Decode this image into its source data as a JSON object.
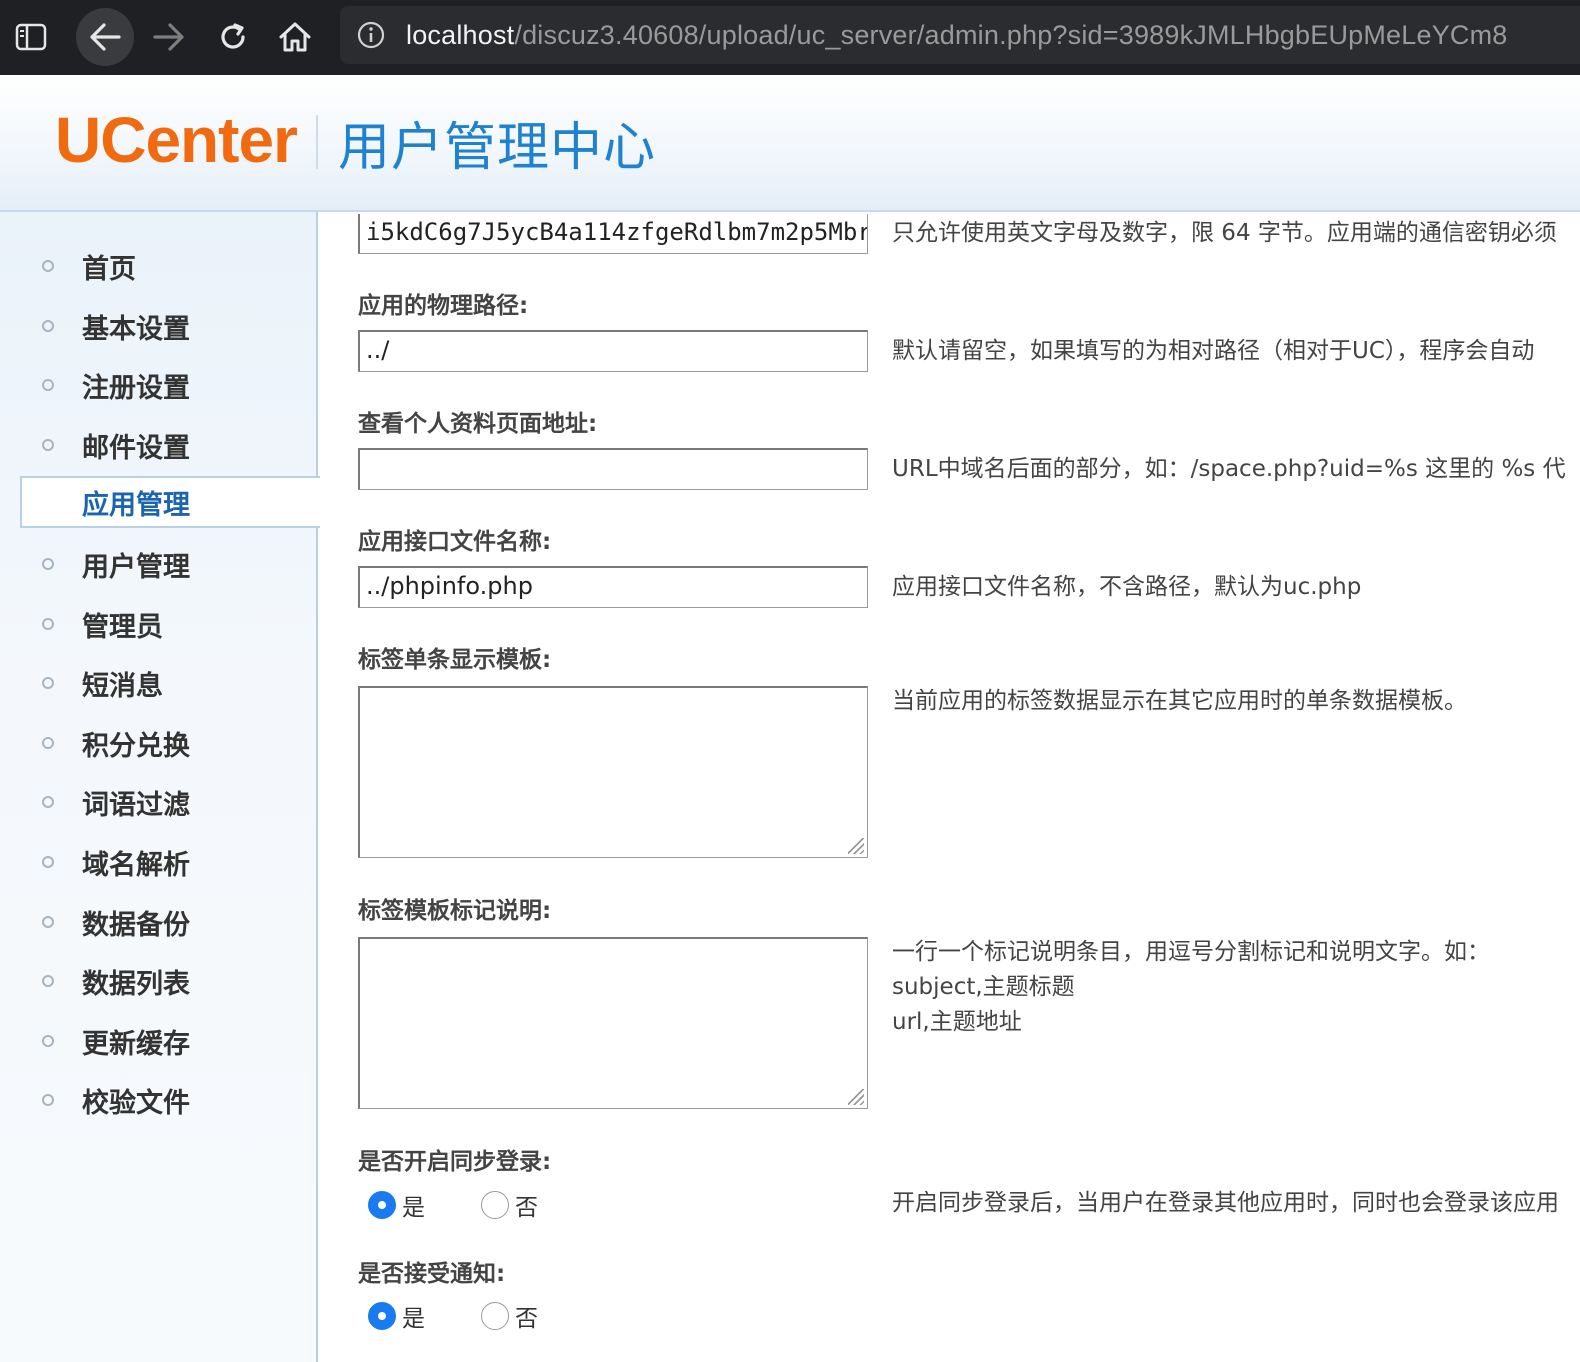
{
  "browser": {
    "url_host": "localhost",
    "url_path": "/discuz3.40608/upload/uc_server/admin.php?sid=3989kJMLHbgbEUpMeLeYCm8"
  },
  "header": {
    "logo": "UCenter",
    "subtitle": "用户管理中心"
  },
  "sidebar": {
    "items": [
      {
        "label": "首页"
      },
      {
        "label": "基本设置"
      },
      {
        "label": "注册设置"
      },
      {
        "label": "邮件设置"
      },
      {
        "label": "应用管理",
        "active": true
      },
      {
        "label": "用户管理"
      },
      {
        "label": "管理员"
      },
      {
        "label": "短消息"
      },
      {
        "label": "积分兑换"
      },
      {
        "label": "词语过滤"
      },
      {
        "label": "域名解析"
      },
      {
        "label": "数据备份"
      },
      {
        "label": "数据列表"
      },
      {
        "label": "更新缓存"
      },
      {
        "label": "校验文件"
      }
    ]
  },
  "form": {
    "authkey": {
      "value": "i5kdC6g7J5ycB4a114zfgeRdlbm7m2p5Mbr",
      "help": "只允许使用英文字母及数字，限 64 字节。应用端的通信密钥必须"
    },
    "path": {
      "label": "应用的物理路径:",
      "value": "../",
      "help": "默认请留空，如果填写的为相对路径（相对于UC），程序会自动"
    },
    "viewprourl": {
      "label": "查看个人资料页面地址:",
      "value": "",
      "help": "URL中域名后面的部分，如：/space.php?uid=%s 这里的 %s 代"
    },
    "apifilename": {
      "label": "应用接口文件名称:",
      "value": "../phpinfo.php",
      "help": "应用接口文件名称，不含路径，默认为uc.php"
    },
    "tagtemplates": {
      "label": "标签单条显示模板:",
      "help": "当前应用的标签数据显示在其它应用时的单条数据模板。"
    },
    "tagfields": {
      "label": "标签模板标记说明:",
      "help_line1": "一行一个标记说明条目，用逗号分割标记和说明文字。如：",
      "help_line2": "subject,主题标题",
      "help_line3": "url,主题地址"
    },
    "synlogin": {
      "label": "是否开启同步登录:",
      "yes": "是",
      "no": "否",
      "selected": "是",
      "help": "开启同步登录后，当用户在登录其他应用时，同时也会登录该应用"
    },
    "recvnote": {
      "label": "是否接受通知:",
      "yes": "是",
      "no": "否",
      "selected": "是"
    }
  },
  "colors": {
    "accent": "#1a7bf0",
    "logo": "#f26a10",
    "subtitle": "#1e82d0"
  }
}
